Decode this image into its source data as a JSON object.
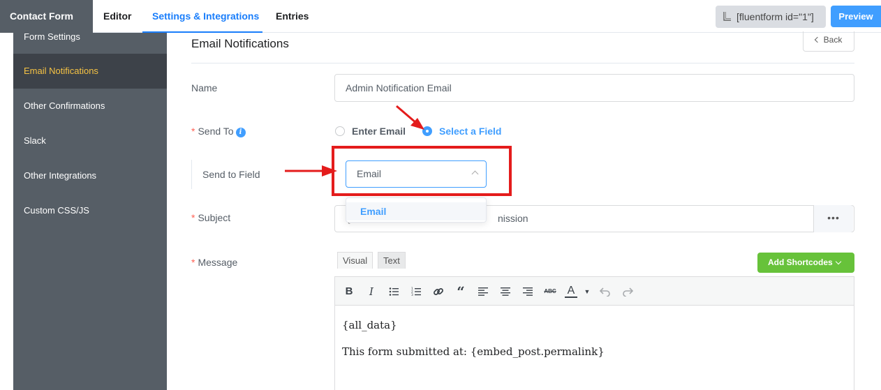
{
  "header": {
    "form_title": "Contact Form (#1)",
    "tabs": [
      {
        "label": "Editor",
        "active": false
      },
      {
        "label": "Settings & Integrations",
        "active": true
      },
      {
        "label": "Entries",
        "active": false
      }
    ],
    "shortcode": "[fluentform id=\"1\"]",
    "preview_label": "Preview"
  },
  "sidebar": {
    "items": [
      {
        "label": "Form Settings",
        "active": false
      },
      {
        "label": "Email Notifications",
        "active": true
      },
      {
        "label": "Other Confirmations",
        "active": false
      },
      {
        "label": "Slack",
        "active": false
      },
      {
        "label": "Other Integrations",
        "active": false
      },
      {
        "label": "Custom CSS/JS",
        "active": false
      }
    ]
  },
  "main": {
    "title": "Email Notifications",
    "back_label": "Back",
    "name": {
      "label": "Name",
      "value": "Admin Notification Email"
    },
    "send_to": {
      "label": "Send To",
      "required": "*",
      "options": [
        {
          "label": "Enter Email",
          "checked": false
        },
        {
          "label": "Select a Field",
          "checked": true
        }
      ]
    },
    "send_to_field": {
      "label": "Send to Field",
      "value": "Email",
      "dropdown_options": [
        "Email"
      ]
    },
    "subject": {
      "label": "Subject",
      "required": "*",
      "value_visible": "nission",
      "more_label": "•••"
    },
    "message": {
      "label": "Message",
      "required": "*",
      "tabs": [
        "Visual",
        "Text"
      ],
      "add_shortcodes_label": "Add Shortcodes",
      "body": [
        "{all_data}",
        "This form submitted at: {embed_post.permalink}"
      ]
    }
  },
  "colors": {
    "accent": "#409eff",
    "sidebar_bg": "#565e66",
    "sidebar_active_text": "#f6c344",
    "green_button": "#67c23a",
    "annotation_red": "#e41c1c"
  }
}
